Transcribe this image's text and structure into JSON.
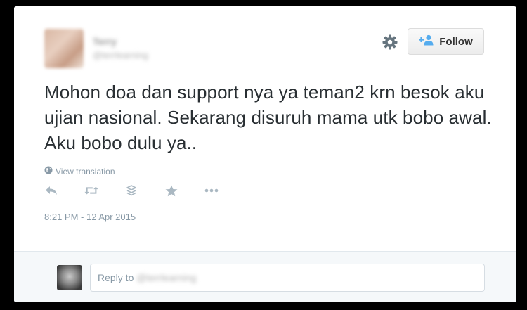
{
  "tweet": {
    "author_name": "Terry",
    "author_handle": "@terrlearning",
    "follow_label": "Follow",
    "text": "Mohon doa dan support nya ya teman2 krn besok aku ujian nasional. Sekarang disuruh mama utk bobo awal. Aku bobo dulu ya..",
    "view_translation": "View translation",
    "timestamp": "8:21 PM - 12 Apr 2015"
  },
  "actions": [
    {
      "icon": "reply-icon"
    },
    {
      "icon": "retweet-icon"
    },
    {
      "icon": "buffer-icon"
    },
    {
      "icon": "favorite-star-icon"
    },
    {
      "icon": "more-icon"
    }
  ],
  "reply": {
    "prefix": "Reply to",
    "handle": "@terrlearning"
  },
  "colors": {
    "text": "#292f33",
    "muted": "#8899a6",
    "follow_icon": "#55acee",
    "background": "#000000"
  }
}
